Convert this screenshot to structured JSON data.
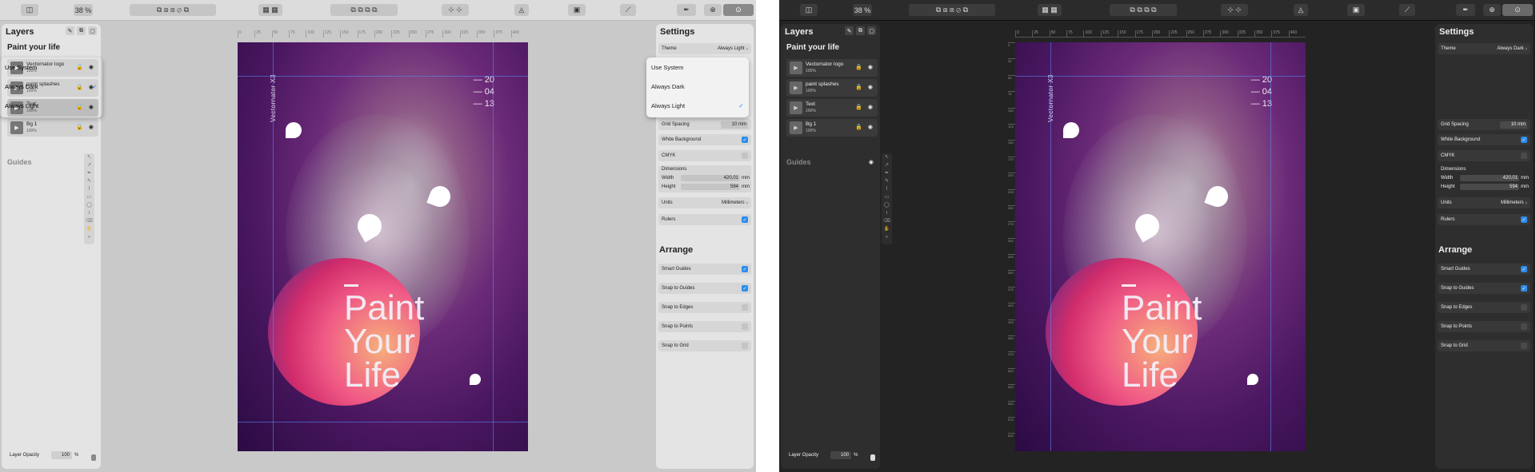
{
  "toolbar": {
    "zoom": "38 %"
  },
  "layers_panel": {
    "title": "Layers",
    "document_title": "Paint your life",
    "items": [
      {
        "name": "Vectornator logo",
        "opacity": "100%"
      },
      {
        "name": "paint splashes",
        "opacity": "100%"
      },
      {
        "name": "Text",
        "opacity": "100%"
      },
      {
        "name": "Bg 1",
        "opacity": "100%"
      }
    ],
    "guides_label": "Guides",
    "layer_opacity_label": "Layer Opacity",
    "layer_opacity_value": "100",
    "layer_opacity_unit": "%"
  },
  "rulers": {
    "top_light": [
      "0",
      "25",
      "50",
      "75",
      "100",
      "125",
      "150",
      "175",
      "200",
      "225",
      "250",
      "275",
      "300",
      "325",
      "350",
      "375",
      "400"
    ],
    "top_dark": [
      "0",
      "25",
      "50",
      "75",
      "100",
      "125",
      "150",
      "175",
      "200",
      "225",
      "250",
      "275",
      "300",
      "325",
      "350",
      "375",
      "400"
    ],
    "left_dark": [
      "0",
      "25",
      "50",
      "75",
      "100",
      "125",
      "150",
      "175",
      "200",
      "225",
      "250",
      "275",
      "300",
      "325",
      "350",
      "375",
      "400",
      "425",
      "450",
      "475",
      "500",
      "525",
      "550",
      "575",
      "600"
    ]
  },
  "poster": {
    "brand": "Vectornator X3",
    "numbers": [
      "20",
      "04",
      "13"
    ],
    "line1": "Paint",
    "line2": "Your",
    "line3": "Life"
  },
  "settings_light": {
    "title": "Settings",
    "theme_label": "Theme",
    "theme_value": "Always Light",
    "menu": [
      {
        "label": "Use System",
        "checked": false
      },
      {
        "label": "Always Dark",
        "checked": false
      },
      {
        "label": "Always Light",
        "checked": true
      }
    ]
  },
  "settings_dark": {
    "title": "Settings",
    "theme_label": "Theme",
    "theme_value": "Always Dark",
    "menu": [
      {
        "label": "Use System",
        "checked": false
      },
      {
        "label": "Always Dark",
        "checked": true
      },
      {
        "label": "Always Light",
        "checked": false
      }
    ]
  },
  "settings_common": {
    "grid_spacing_label": "Grid Spacing",
    "grid_spacing_value": "10 mm",
    "white_background_label": "White Background",
    "white_background": true,
    "cmyk_label": "CMYK",
    "cmyk": false,
    "dimensions_label": "Dimensions",
    "width_label": "Width",
    "width_value": "420,01",
    "height_label": "Height",
    "height_value": "594",
    "dim_unit": "mm",
    "units_label": "Units",
    "units_value": "Millimeters",
    "rulers_label": "Rulers",
    "rulers": true,
    "arrange_title": "Arrange",
    "smart_guides_label": "Smart Guides",
    "smart_guides": true,
    "snap_guides_label": "Snap to Guides",
    "snap_guides": true,
    "snap_edges_label": "Snap to Edges",
    "snap_edges": false,
    "snap_points_label": "Snap to Points",
    "snap_points": false,
    "snap_grid_label": "Snap to Grid",
    "snap_grid": false
  },
  "colors": {
    "accent": "#2d8ceb",
    "light_bg": "#c9c9c9",
    "dark_bg": "#232323"
  }
}
